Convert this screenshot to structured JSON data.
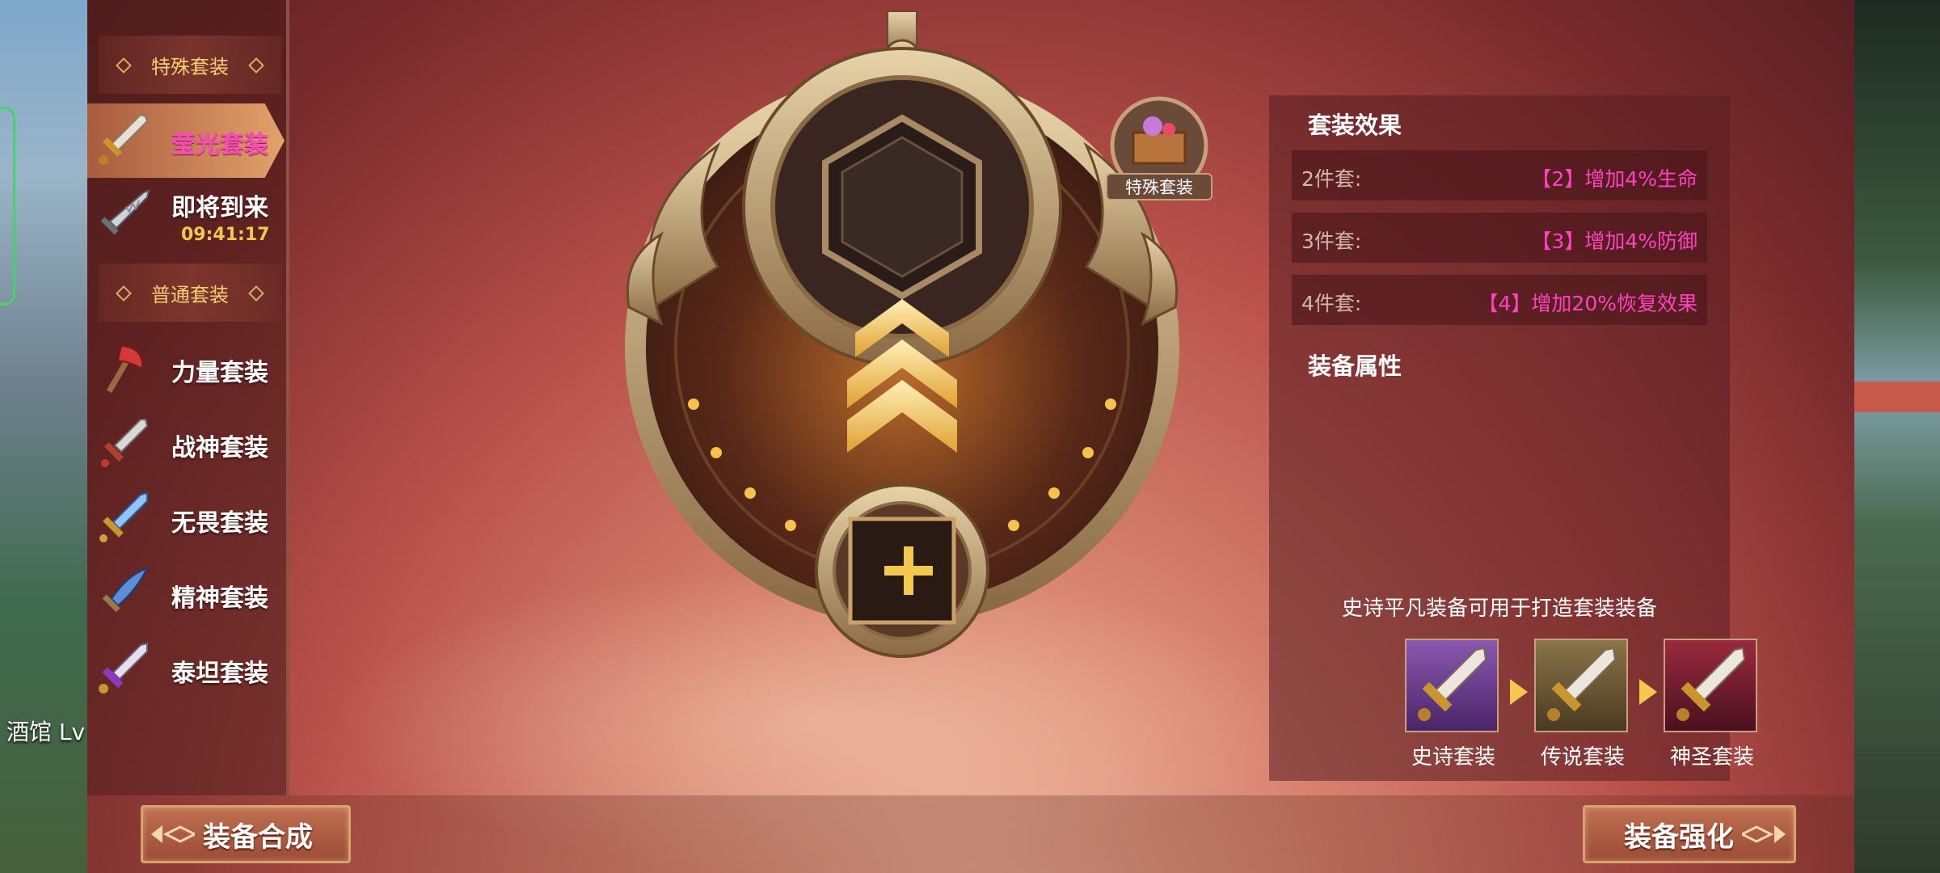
{
  "background": {
    "left_label": "酒馆 Lv"
  },
  "sidebar": {
    "special_header": "特殊套装",
    "normal_header": "普通套装",
    "special_items": [
      {
        "label": "莹光套装",
        "icon": "glow-sword-icon",
        "active": true
      },
      {
        "label": "即将到来",
        "icon": "serrated-blade-icon",
        "timer": "09:41:17"
      }
    ],
    "normal_items": [
      {
        "label": "力量套装",
        "icon": "red-axe-icon"
      },
      {
        "label": "战神套装",
        "icon": "dagger-icon"
      },
      {
        "label": "无畏套装",
        "icon": "blue-sword-icon"
      },
      {
        "label": "精神套装",
        "icon": "spirit-blade-icon"
      },
      {
        "label": "泰坦套装",
        "icon": "purple-sword-icon"
      }
    ]
  },
  "badge": {
    "label": "特殊套装",
    "icon": "treasure-chest-icon"
  },
  "effects": {
    "title": "套装效果",
    "rows": [
      {
        "key": "2件套:",
        "value": "【2】增加4%生命"
      },
      {
        "key": "3件套:",
        "value": "【3】增加4%防御"
      },
      {
        "key": "4件套:",
        "value": "【4】增加20%恢复效果"
      }
    ],
    "attr_title": "装备属性",
    "note": "史诗平凡装备可用于打造套装装备",
    "tiers": [
      {
        "label": "史诗套装",
        "color": "#6e3a8c"
      },
      {
        "label": "传说套装",
        "color": "#7a6238"
      },
      {
        "label": "神圣套装",
        "color": "#8a2436"
      }
    ]
  },
  "buttons": {
    "synthesize": "装备合成",
    "enhance": "装备强化"
  },
  "colors": {
    "accent_gold": "#f2c94c",
    "active_label": "#ff49c3",
    "effect_value": "#ff43c0"
  }
}
